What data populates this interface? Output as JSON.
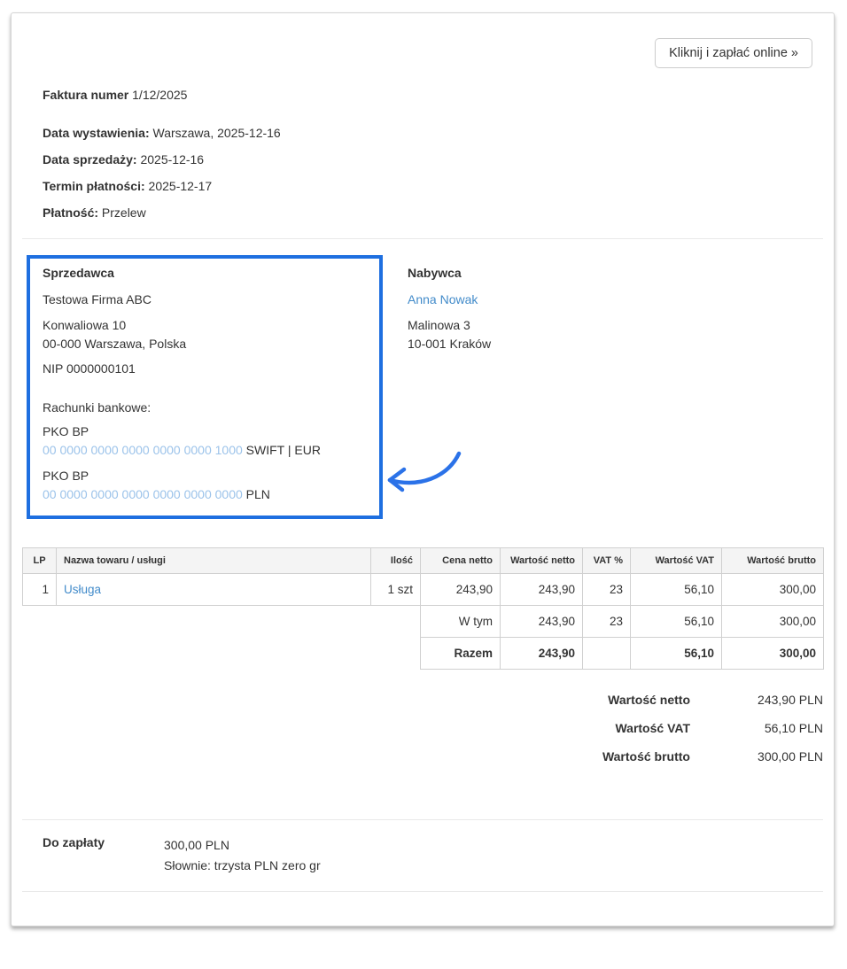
{
  "pay_button": {
    "label": "Kliknij i zapłać online »"
  },
  "invoice": {
    "number_label": "Faktura numer",
    "number": "1/12/2025",
    "dates": [
      {
        "label": "Data wystawienia:",
        "value": "Warszawa, 2025-12-16"
      },
      {
        "label": "Data sprzedaży:",
        "value": "2025-12-16"
      },
      {
        "label": "Termin płatności:",
        "value": "2025-12-17"
      },
      {
        "label": "Płatność:",
        "value": "Przelew"
      }
    ]
  },
  "seller": {
    "title": "Sprzedawca",
    "name": "Testowa Firma ABC",
    "address_line1": "Konwaliowa 10",
    "address_line2": "00-000 Warszawa, Polska",
    "tax_id": "NIP 0000000101",
    "bank_accounts_label": "Rachunki bankowe:",
    "accounts": [
      {
        "bank": "PKO BP",
        "number": "00 0000 0000 0000 0000 0000 1000",
        "suffix": "SWIFT | EUR"
      },
      {
        "bank": "PKO BP",
        "number": "00 0000 0000 0000 0000 0000 0000",
        "suffix": "PLN"
      }
    ]
  },
  "buyer": {
    "title": "Nabywca",
    "name": "Anna Nowak",
    "address_line1": "Malinowa 3",
    "address_line2": "10-001 Kraków"
  },
  "table": {
    "headers": [
      "LP",
      "Nazwa towaru / usługi",
      "Ilość",
      "Cena netto",
      "Wartość netto",
      "VAT %",
      "Wartość VAT",
      "Wartość brutto"
    ],
    "rows": [
      {
        "lp": "1",
        "name": "Usługa",
        "qty": "1 szt",
        "unit_net": "243,90",
        "net": "243,90",
        "vat_rate": "23",
        "vat": "56,10",
        "gross": "300,00"
      }
    ],
    "subtotal_row": {
      "label": "W tym",
      "net": "243,90",
      "vat_rate": "23",
      "vat": "56,10",
      "gross": "300,00"
    },
    "total_row": {
      "label": "Razem",
      "net": "243,90",
      "vat_rate": "",
      "vat": "56,10",
      "gross": "300,00"
    }
  },
  "summary": [
    {
      "label": "Wartość netto",
      "value": "243,90 PLN"
    },
    {
      "label": "Wartość VAT",
      "value": "56,10 PLN"
    },
    {
      "label": "Wartość brutto",
      "value": "300,00 PLN"
    }
  ],
  "payment_due": {
    "label": "Do zapłaty",
    "amount": "300,00 PLN",
    "in_words": "Słownie: trzysta PLN zero gr"
  },
  "colors": {
    "link": "#428bca",
    "iban_link": "#9cc3ea",
    "highlight_box": "#1e6fe0",
    "annotation_arrow": "#2b72e8"
  }
}
